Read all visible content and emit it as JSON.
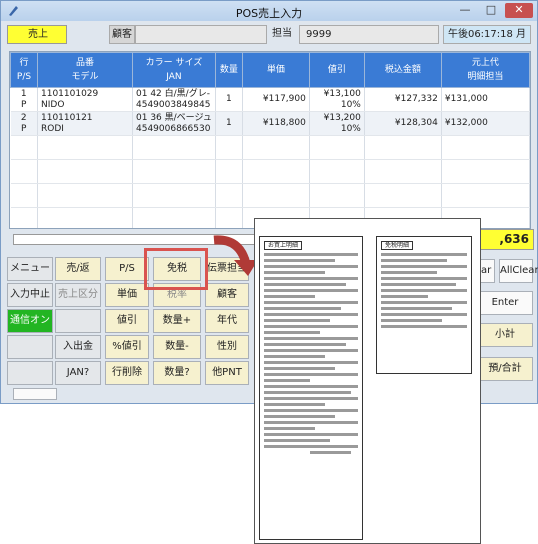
{
  "window": {
    "title": "POS売上入力"
  },
  "header": {
    "mode": "売上",
    "customer_btn": "顧客",
    "staff_label": "担当",
    "staff_code": "9999",
    "datetime": "午後06:17:18 月"
  },
  "grid": {
    "columns": {
      "row": [
        "行",
        "P/S"
      ],
      "item": [
        "品番",
        "モデル"
      ],
      "color_size": [
        "カラー サイズ",
        "JAN"
      ],
      "qty": [
        "数量"
      ],
      "price": [
        "単価"
      ],
      "discount": [
        "値引"
      ],
      "amount": [
        "税込金額"
      ],
      "sales": [
        "元上代",
        "明細担当"
      ]
    },
    "rows": [
      {
        "no": "1",
        "ps": "P",
        "code": "1101101029",
        "model": "NIDO",
        "color": "01 42 白/黒/グレ-",
        "jan": "4549003849845",
        "qty": "1",
        "price": "¥117,900",
        "disc": "¥13,100",
        "disc_pct": "10%",
        "amount": "¥127,332",
        "orig": "¥131,000"
      },
      {
        "no": "2",
        "ps": "P",
        "code": "110110121",
        "model": "RODI",
        "color": "01 36 黒/ベージュ",
        "jan": "4549006866530",
        "qty": "1",
        "price": "¥118,800",
        "disc": "¥13,200",
        "disc_pct": "10%",
        "amount": "¥128,304",
        "orig": "¥132,000"
      }
    ]
  },
  "totals": {
    "shown": ",636"
  },
  "buttons": {
    "menu": "メニューへ",
    "sale_return": "売/返",
    "ps": "P/S",
    "tax_free": "免税",
    "slip_staff": "伝票担当",
    "input_stop": "入力中止",
    "sale_kind": "売上区分",
    "unit_price": "単価",
    "tax_rate": "税率",
    "customer": "顧客",
    "comm_on": "通信オン",
    "discount": "値引",
    "qty_plus": "数量+",
    "age": "年代",
    "cash_inout": "入出金",
    "pct_discount": "%値引",
    "qty_minus": "数量-",
    "gender": "性別",
    "jan_q": "JAN?",
    "delete_row": "行削除",
    "qty_q": "数量?",
    "other_pnt": "他PNT",
    "clear": "ear",
    "allclear": "AllClear",
    "enter": "Enter",
    "subtotal": "小計",
    "deposit_total": "預/合計"
  },
  "receipt": {
    "a_badge": "お買上明細",
    "b_badge": "免税明細"
  }
}
